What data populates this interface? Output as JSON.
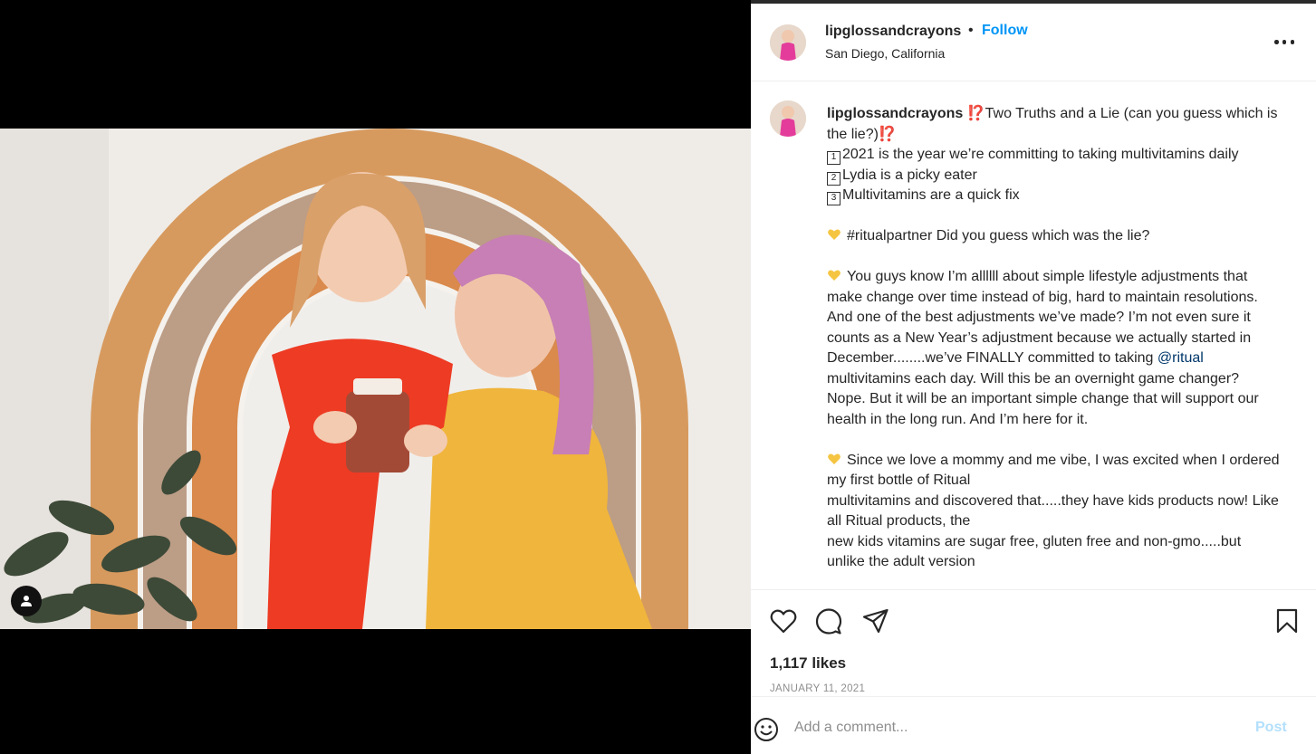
{
  "header": {
    "username": "lipglossandcrayons",
    "separator": "•",
    "follow_label": "Follow",
    "location": "San Diego, California",
    "more_icon": "more-horizontal-icon"
  },
  "caption": {
    "username": "lipglossandcrayons",
    "lines": [
      "⁉️Two Truths and a Lie (can you guess which is the lie?)⁉️",
      "2021 is the year we’re committing to taking multivitamins daily",
      "Lydia is a picky eater",
      "Multivitamins are a quick fix",
      "#ritualpartner Did you guess which was the lie?",
      "You guys know I’m allllll about simple lifestyle adjustments that make change over time instead of big, hard to maintain resolutions. And one of the best adjustments we’ve made? I’m not even sure it counts as a New Year’s adjustment because we actually started in December........we’ve FINALLY committed to taking ",
      "@ritual",
      " multivitamins each day. Will this be an overnight game changer? Nope. But it will be an important simple change that will support our health in the long run. And I’m here for it.",
      "Since we love a mommy and me vibe, I was excited when I ordered my first bottle of Ritual",
      "multivitamins and discovered that.....they have kids products now! Like all Ritual products, the",
      "new kids vitamins are sugar free, gluten free and non-gmo.....but unlike the adult version"
    ],
    "numbers": [
      "1",
      "2",
      "3"
    ],
    "heart_emoji_color": "#f5c542"
  },
  "actions": {
    "likes": "1,117 likes",
    "date": "JANUARY 11, 2021",
    "icons": [
      "heart-icon",
      "comment-icon",
      "share-icon",
      "bookmark-icon"
    ]
  },
  "comment": {
    "placeholder": "Add a comment...",
    "post_label": "Post"
  },
  "colors": {
    "follow": "#0095f6",
    "post_disabled": "#b2dffc",
    "text": "#262626",
    "muted": "#8e8e8e"
  }
}
